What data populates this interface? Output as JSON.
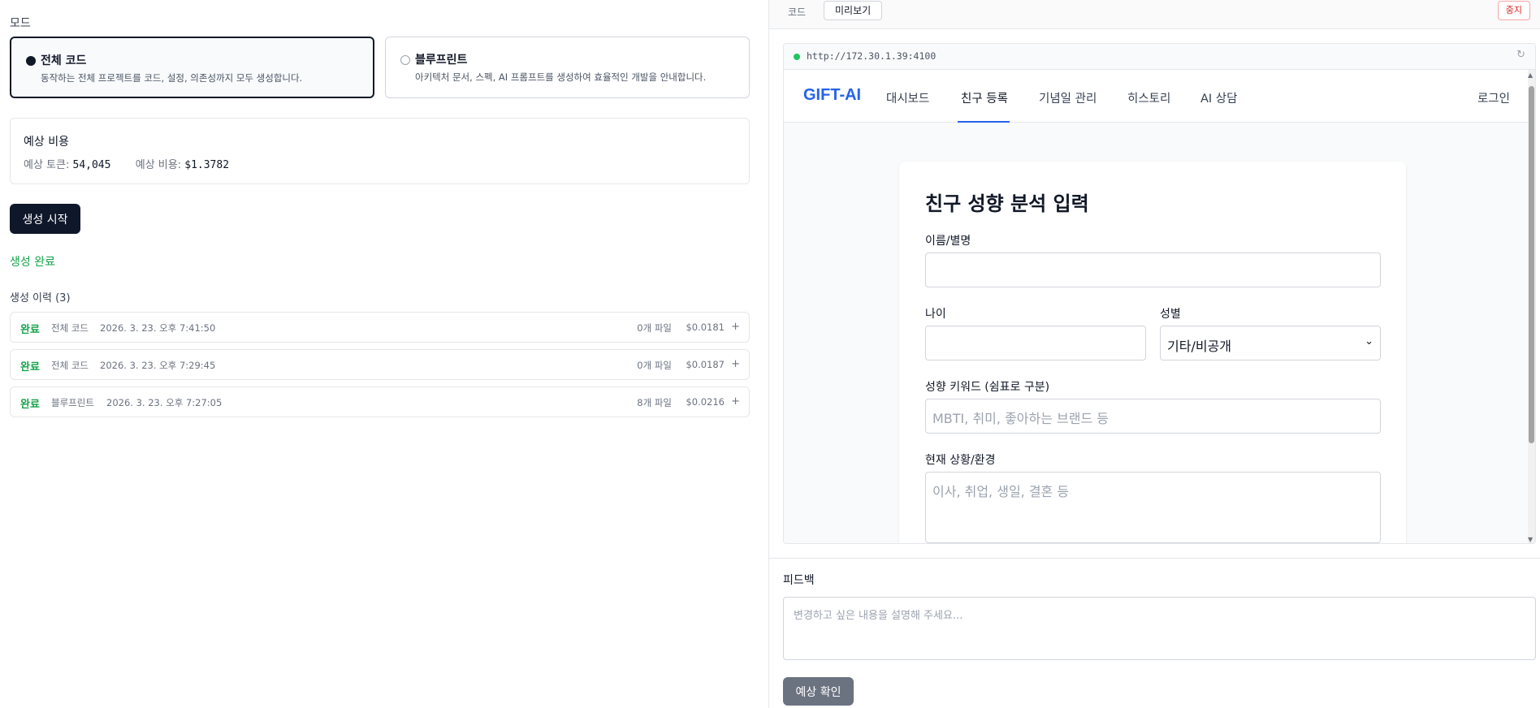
{
  "mode": {
    "label": "모드",
    "options": [
      {
        "title": "전체 코드",
        "desc": "동작하는 전체 프로젝트를 코드, 설정, 의존성까지 모두 생성합니다.",
        "selected": true
      },
      {
        "title": "블루프린트",
        "desc": "아키텍처 문서, 스펙, AI 프롬프트를 생성하여 효율적인 개발을 안내합니다.",
        "selected": false
      }
    ]
  },
  "estimate": {
    "title": "예상 비용",
    "tokens_label": "예상 토큰:",
    "tokens_value": "54,045",
    "cost_label": "예상 비용:",
    "cost_value": "$1.3782"
  },
  "start_button": "생성 시작",
  "status_text": "생성 완료",
  "history": {
    "title": "생성 이력 (3)",
    "rows": [
      {
        "status": "완료",
        "mode": "전체 코드",
        "time": "2026. 3. 23. 오후 7:41:50",
        "files": "0개 파일",
        "cost": "$0.0181",
        "expand": "+"
      },
      {
        "status": "완료",
        "mode": "전체 코드",
        "time": "2026. 3. 23. 오후 7:29:45",
        "files": "0개 파일",
        "cost": "$0.0187",
        "expand": "+"
      },
      {
        "status": "완료",
        "mode": "블루프린트",
        "time": "2026. 3. 23. 오후 7:27:05",
        "files": "8개 파일",
        "cost": "$0.0216",
        "expand": "+"
      }
    ]
  },
  "right_tabs": {
    "code": "코드",
    "preview": "미리보기",
    "stop": "중지"
  },
  "browser": {
    "url": "http://172.30.1.39:4100",
    "reload_icon": "↻"
  },
  "site": {
    "brand": "GIFT-AI",
    "nav": [
      "대시보드",
      "친구 등록",
      "기념일 관리",
      "히스토리",
      "AI 상담"
    ],
    "active_nav": "친구 등록",
    "login": "로그인",
    "form": {
      "title": "친구 성향 분석 입력",
      "name_label": "이름/별명",
      "age_label": "나이",
      "gender_label": "성별",
      "gender_value": "기타/비공개",
      "keywords_label": "성향 키워드 (쉼표로 구분)",
      "keywords_placeholder": "MBTI, 취미, 좋아하는 브랜드 등",
      "situation_label": "현재 상황/환경",
      "situation_placeholder": "이사, 취업, 생일, 결혼 등"
    }
  },
  "feedback": {
    "label": "피드백",
    "placeholder": "변경하고 싶은 내용을 설명해 주세요...",
    "button": "예상 확인"
  },
  "colors": {
    "accent": "#2563eb",
    "success": "#16a34a",
    "primary_button": "#0f172a",
    "danger": "#dc2626"
  }
}
